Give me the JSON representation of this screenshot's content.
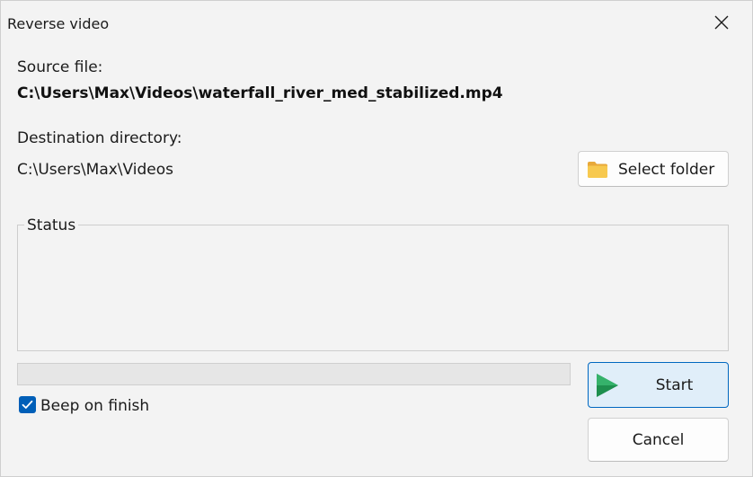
{
  "window": {
    "title": "Reverse video"
  },
  "source": {
    "label": "Source file:",
    "path": "C:\\Users\\Max\\Videos\\waterfall_river_med_stabilized.mp4"
  },
  "destination": {
    "label": "Destination directory:",
    "path": "C:\\Users\\Max\\Videos",
    "select_folder_label": "Select folder"
  },
  "status": {
    "legend": "Status",
    "text": ""
  },
  "progress": {
    "fraction": 0
  },
  "beep": {
    "label": "Beep on finish",
    "checked": true
  },
  "actions": {
    "start_label": "Start",
    "cancel_label": "Cancel"
  },
  "icons": {
    "close": "close-icon",
    "folder": "folder-icon",
    "play": "play-icon",
    "check": "checkmark-icon"
  },
  "colors": {
    "accent": "#005fb8",
    "start_border": "#0067c0",
    "start_bg": "#e0eef9",
    "play_green": "#1e8f4e",
    "folder_yellow": "#f4c04e"
  }
}
